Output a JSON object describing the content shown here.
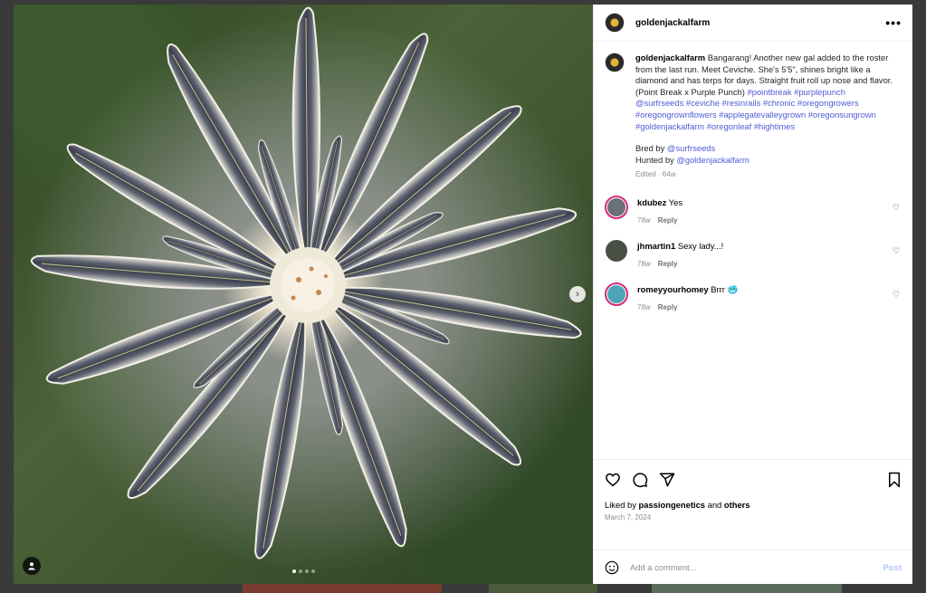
{
  "post": {
    "username": "goldenjackalfarm",
    "more_icon": "more-horizontal-icon"
  },
  "caption": {
    "username": "goldenjackalfarm",
    "text": "Bangarang! Another new gal added to the roster from the last run. Meet Ceviche. She's 5'5\", shines bright like a diamond and has terps for days. Straight fruit roll up nose and flavor. (Point Break x Purple Punch)",
    "hashtags": [
      "#pointbreak",
      "#purplepunch",
      "@surfrseeds",
      "#ceviche",
      "#resinrails",
      "#chronic",
      "#oregongrowers",
      "#oregongrownflowers",
      "#applegatevalleygrown",
      "#oregonsungrown",
      "#goldenjackalfarm",
      "#oregonleaf",
      "#hightimes"
    ],
    "bred_by_label": "Bred by",
    "bred_by": "@surfrseeds",
    "hunted_by_label": "Hunted by",
    "hunted_by": "@goldenjackalfarm",
    "meta": "Edited · 64w"
  },
  "comments": [
    {
      "username": "kdubez",
      "text": "Yes",
      "time": "78w",
      "reply": "Reply",
      "avatar_color": "#6b6f7a",
      "ring": true
    },
    {
      "username": "jhmartin1",
      "text": "Sexy lady...!",
      "time": "78w",
      "reply": "Reply",
      "avatar_color": "#4a4f46",
      "ring": false
    },
    {
      "username": "romeyyourhomey",
      "text": "Brrr 🥶",
      "time": "78w",
      "reply": "Reply",
      "avatar_color": "#4ba7b8",
      "ring": true
    }
  ],
  "actions": {
    "liked_by_prefix": "Liked by",
    "liked_by_user": "passiongenetics",
    "liked_by_and": "and",
    "liked_by_others": "others",
    "date": "March 7, 2024"
  },
  "add_comment": {
    "placeholder": "Add a comment...",
    "post_label": "Post"
  },
  "media": {
    "next_icon": "chevron-right-icon",
    "tag_icon": "user-tag-icon",
    "slide_count": 4,
    "current_slide": 1
  },
  "colors": {
    "link": "#4f5bd5",
    "story_ring": "#d62976",
    "post_button": "#b2c6f5"
  }
}
